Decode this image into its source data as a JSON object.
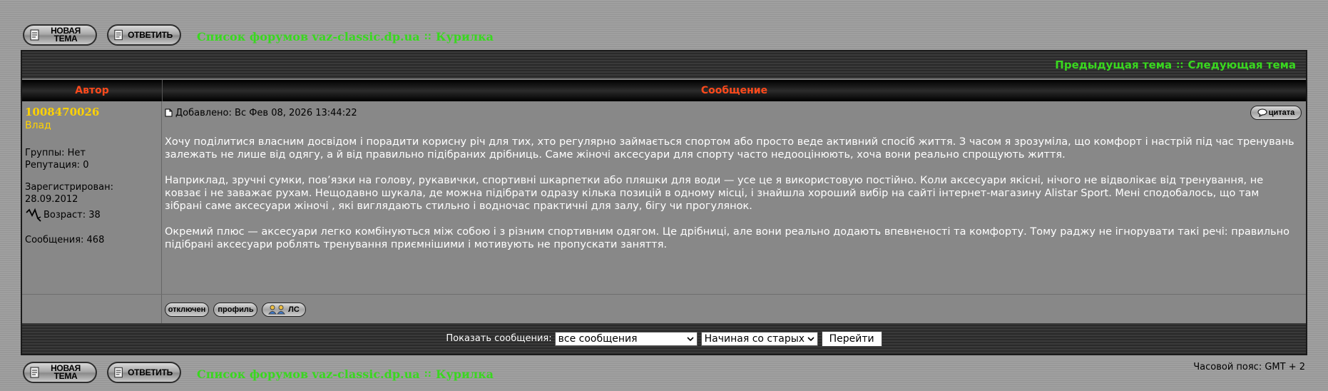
{
  "toolbar": {
    "new_topic_label": "НОВАЯ ТЕМА",
    "reply_label": "ОТВЕТИТЬ"
  },
  "breadcrumb": {
    "forum_list": "Список форумов vaz-classic.dp.ua",
    "separator": "::",
    "current": "Курилка"
  },
  "topic_nav": {
    "prev": "Предыдущая тема",
    "separator": "::",
    "next": "Следующая тема"
  },
  "columns": {
    "author": "Автор",
    "message": "Сообщение"
  },
  "post": {
    "author_name": "1008470026",
    "author_title": "Влад",
    "groups": "Группы: Нет",
    "reputation": "Репутация: 0",
    "registered_label": "Зарегистрирован:",
    "registered_date": "28.09.2012",
    "age": "Возраст: 38",
    "messages": "Сообщения: 468",
    "date": "Добавлено: Вс Фев 08, 2026 13:44:22",
    "quote_label": "цитата",
    "p1": "Хочу поділитися власним досвідом і порадити корисну річ для тих, хто регулярно займається спортом або просто веде активний спосіб життя. З часом я зрозуміла, що комфорт і настрій під час тренувань залежать не лише від одягу, а й від правильно підібраних дрібниць. Саме жіночі аксесуари для спорту часто недооцінюють, хоча вони реально спрощують життя.",
    "p2_before": "Наприклад, зручні сумки, пов’язки на голову, рукавички, спортивні шкарпетки або пляшки для води — усе це я використовую постійно. Коли аксесуари якісні, нічого не відволікає від тренування, не ковзає і не заважає рухам. Нещодавно шукала, де можна підібрати одразу кілька позицій в одному місці, і знайшла хороший вибір на сайті інтернет-магазину Alistar Sport. Мені сподобалось, що там зібрані саме",
    "p2_link": "аксесуари жіночі",
    "p2_after": ", які виглядають стильно і водночас практичні для залу, бігу чи прогулянок.",
    "p3": "Окремий плюс — аксесуари легко комбінуються між собою і з різним спортивним одягом. Це дрібниці, але вони реально додають впевненості та комфорту. Тому раджу не ігнорувати такі речі: правильно підібрані аксесуари роблять тренування приємнішими і мотивують не пропускати заняття."
  },
  "post_buttons": {
    "offline": "отключен",
    "profile": "профиль",
    "pm": "ЛС"
  },
  "display": {
    "label": "Показать сообщения:",
    "filter_value": "все сообщения",
    "order_value": "Начиная со старых",
    "go_label": "Перейти"
  },
  "timezone": "Часовой пояс: GMT + 2"
}
